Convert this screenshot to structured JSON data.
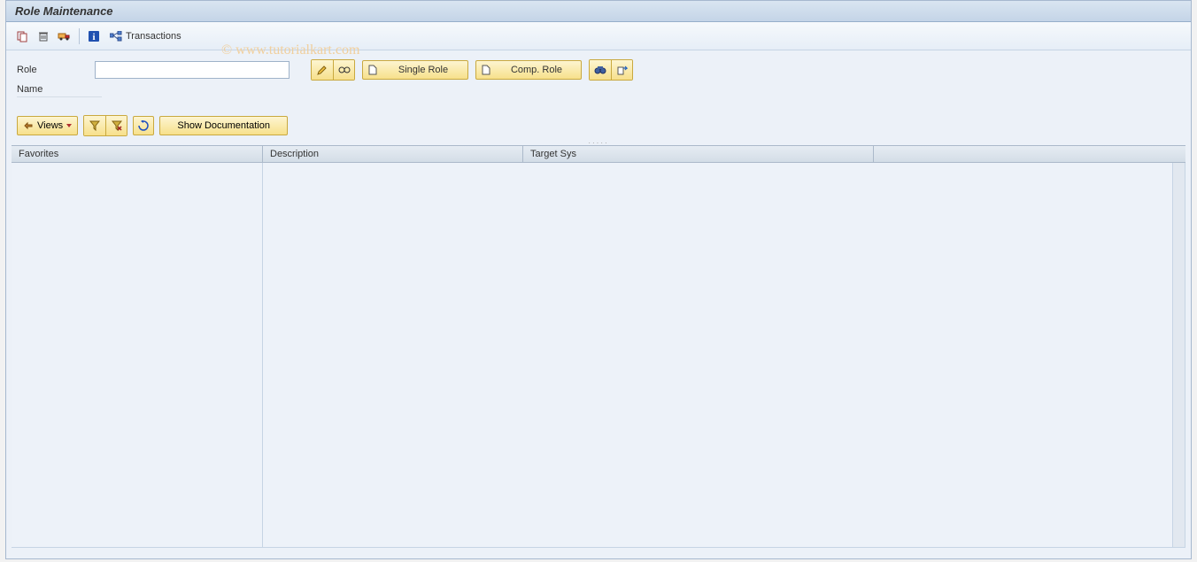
{
  "title": "Role Maintenance",
  "toolbar": {
    "transactions_label": "Transactions"
  },
  "form": {
    "role_label": "Role",
    "role_value": "",
    "name_label": "Name",
    "single_role_label": "Single Role",
    "comp_role_label": "Comp. Role"
  },
  "sub_toolbar": {
    "views_label": "Views",
    "show_doc_label": "Show Documentation"
  },
  "grid": {
    "columns": {
      "favorites": "Favorites",
      "description": "Description",
      "target_sys": "Target Sys"
    }
  },
  "watermark": "© www.tutorialkart.com"
}
